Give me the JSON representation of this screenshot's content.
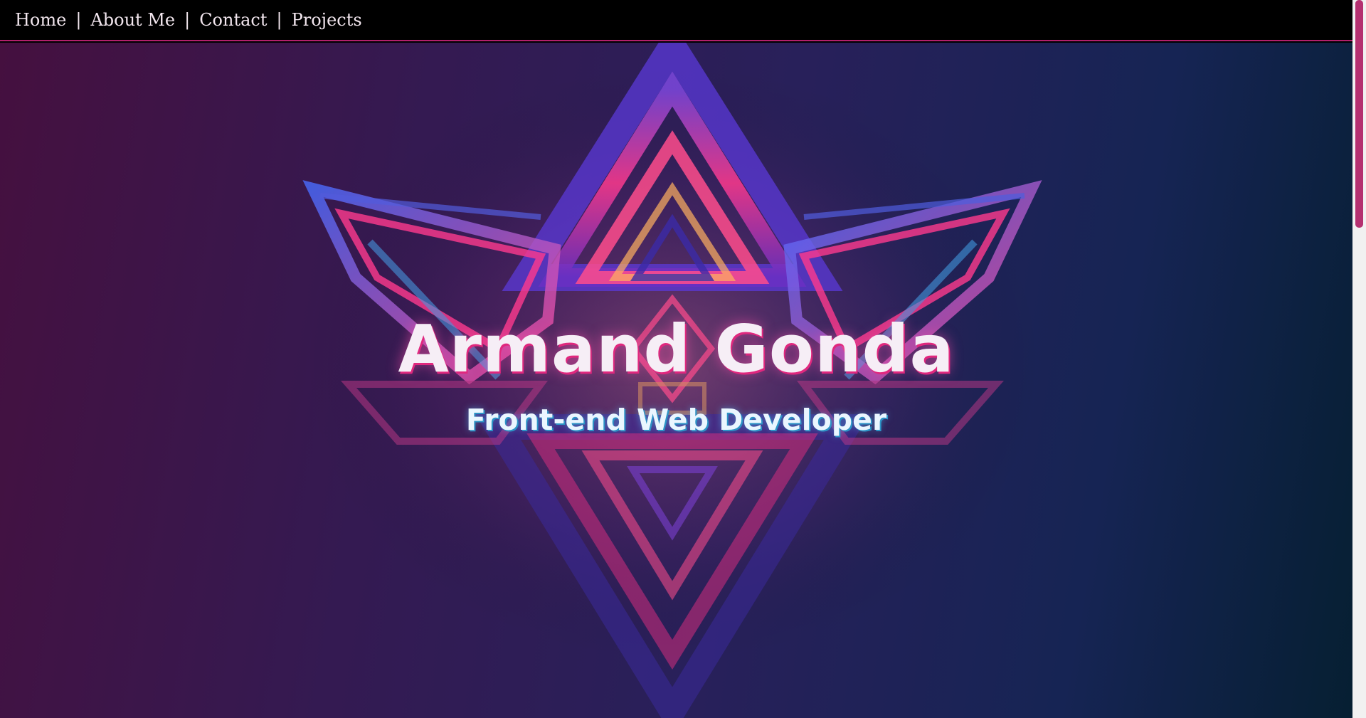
{
  "nav": {
    "items": [
      {
        "label": "Home"
      },
      {
        "label": "About Me"
      },
      {
        "label": "Contact"
      },
      {
        "label": "Projects"
      }
    ],
    "separator": "|"
  },
  "hero": {
    "title": "Armand Gonda",
    "subtitle": "Front-end Web Developer"
  },
  "colors": {
    "nav_background": "#000000",
    "nav_border": "#b3206d",
    "title_shadow": "#e0287e",
    "subtitle_shadow": "#2c93c6",
    "background_left": "#45103f",
    "background_right": "#061f32"
  }
}
